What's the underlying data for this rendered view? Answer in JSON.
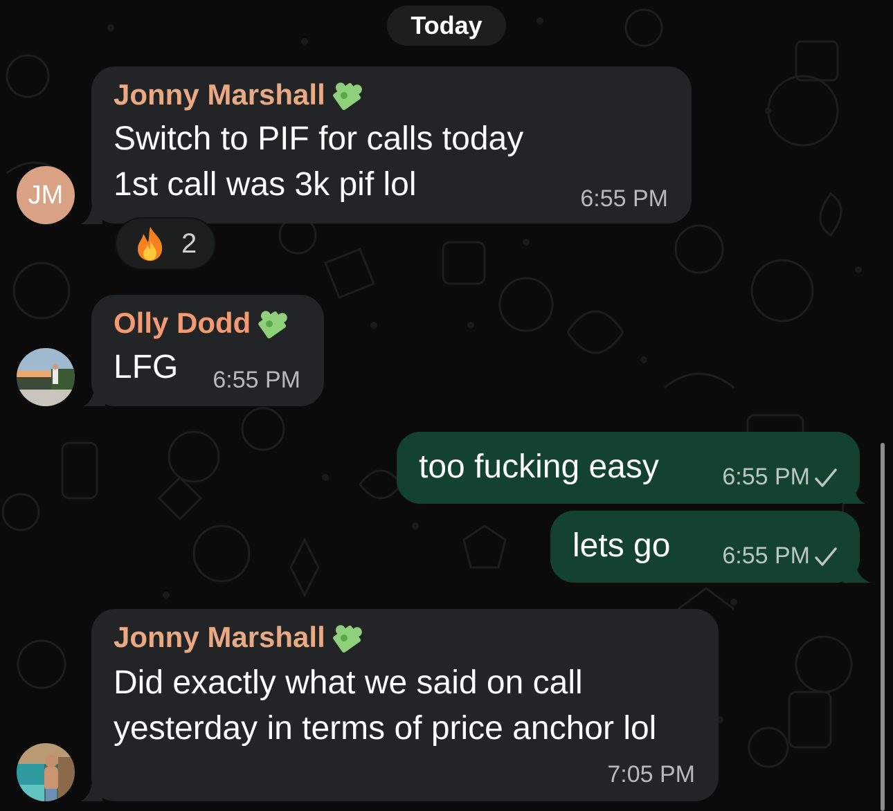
{
  "date_separator": "Today",
  "colors": {
    "background": "#0b0b0b",
    "incoming_bubble": "#232425",
    "outgoing_bubble": "#134230",
    "sender_jonny": "#e8a983",
    "sender_olly": "#f39a72",
    "timestamp": "#b8bab9",
    "check": "#b9c7bf",
    "avatar_jm": "#d9a285"
  },
  "messages": [
    {
      "direction": "incoming",
      "sender": "Jonny Marshall",
      "sender_icon": "puzzle-piece-icon",
      "lines": [
        "Switch to PIF for calls today",
        "1st call was 3k pif lol"
      ],
      "time": "6:55 PM",
      "avatar_initials": "JM",
      "reaction": {
        "icon": "fire-icon",
        "count": "2"
      }
    },
    {
      "direction": "incoming",
      "sender": "Olly Dodd",
      "sender_icon": "puzzle-piece-icon",
      "lines": [
        "LFG"
      ],
      "time": "6:55 PM",
      "avatar": "photo-avatar-olly"
    },
    {
      "direction": "outgoing",
      "lines": [
        "too fucking easy"
      ],
      "time": "6:55 PM",
      "status": "sent-check-icon"
    },
    {
      "direction": "outgoing",
      "lines": [
        "lets go"
      ],
      "time": "6:55 PM",
      "status": "sent-check-icon"
    },
    {
      "direction": "incoming",
      "sender": "Jonny Marshall",
      "sender_icon": "puzzle-piece-icon",
      "lines": [
        "Did exactly what we said on call",
        "yesterday in terms of price anchor lol"
      ],
      "time": "7:05 PM",
      "avatar": "photo-avatar-jonny"
    }
  ]
}
